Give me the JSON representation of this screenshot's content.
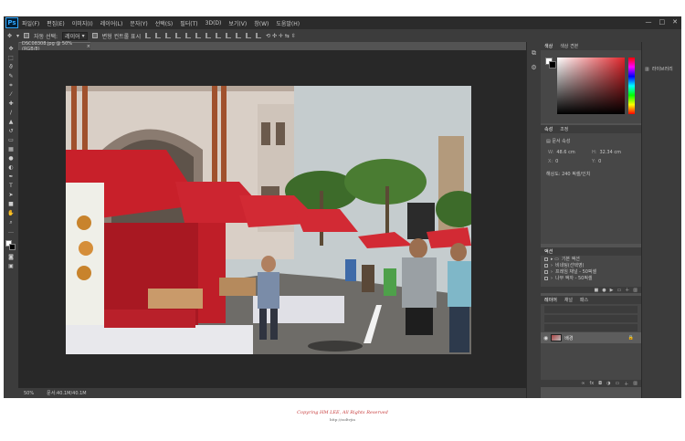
{
  "app": {
    "logo": "Ps"
  },
  "menu": [
    "파일(F)",
    "편집(E)",
    "이미지(I)",
    "레이어(L)",
    "문자(Y)",
    "선택(S)",
    "필터(T)",
    "3D(D)",
    "보기(V)",
    "창(W)",
    "도움말(H)"
  ],
  "window_controls": {
    "minimize": "—",
    "maximize": "□",
    "close": "✕"
  },
  "options_bar": {
    "auto_select_label": "자동 선택:",
    "auto_select_value": "레이어",
    "transform_controls_label": "변형 컨트롤 표시"
  },
  "document": {
    "tab_title": "DSC08308.jpg @ 50% (RGB/8)",
    "close_label": "×"
  },
  "status_bar": {
    "zoom": "50%",
    "doc_info": "문서:40.1M/40.1M"
  },
  "panels": {
    "color_tabs": [
      "색상",
      "색상 견본"
    ],
    "properties_tabs": [
      "속성",
      "조정"
    ],
    "properties": {
      "section_title": "문서 속성",
      "width_label": "W:",
      "width_value": "48.6 cm",
      "height_label": "H:",
      "height_value": "32.34 cm",
      "x_label": "X:",
      "x_value": "0",
      "y_label": "Y:",
      "y_value": "0",
      "resolution": "해상도: 240 픽셀/인치"
    },
    "actions_tab": "액션",
    "actions": [
      "기본 액션",
      "비네팅(선택영)",
      "프레임 채널 - 50픽셀",
      "나무 액자 - 50픽셀"
    ],
    "layers_tabs": [
      "레이어",
      "채널",
      "패스"
    ],
    "layer": {
      "name": "배경"
    }
  },
  "right_dock": {
    "label": "라이브러리"
  },
  "toolbar_tools": [
    "move-tool",
    "marquee-tool",
    "lasso-tool",
    "quick-select-tool",
    "crop-tool",
    "eyedropper-tool",
    "healing-tool",
    "brush-tool",
    "stamp-tool",
    "history-brush-tool",
    "eraser-tool",
    "gradient-tool",
    "blur-tool",
    "dodge-tool",
    "pen-tool",
    "type-tool",
    "path-select-tool",
    "shape-tool",
    "hand-tool",
    "zoom-tool"
  ],
  "colors": {
    "menubar": "#2b2b2b",
    "panel": "#535353",
    "canvas_bg": "#282828",
    "copyright_red": "#c73c3c"
  },
  "footer": {
    "copyright": "Copyring HM LEE, All Rights Reserved",
    "url": "http://ssdtvjin"
  }
}
